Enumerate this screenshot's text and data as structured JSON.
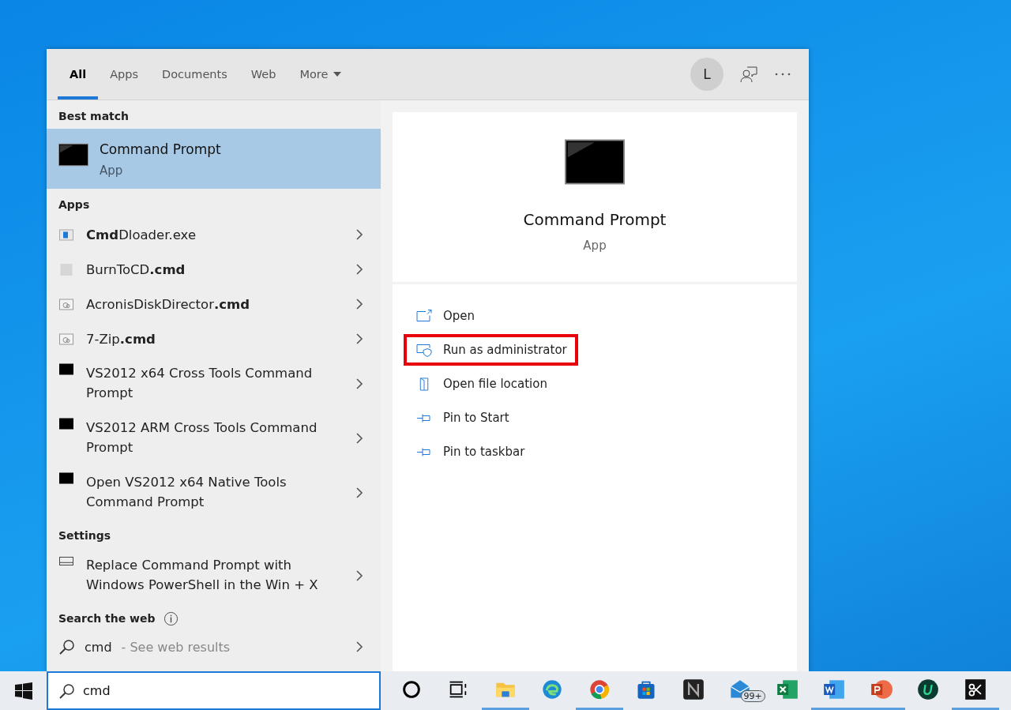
{
  "tabs": [
    {
      "label": "All",
      "selected": true
    },
    {
      "label": "Apps",
      "selected": false
    },
    {
      "label": "Documents",
      "selected": false
    },
    {
      "label": "Web",
      "selected": false
    },
    {
      "label": "More",
      "selected": false,
      "dropdown": true
    }
  ],
  "account": {
    "initial": "L"
  },
  "best_match": {
    "heading": "Best match",
    "item": {
      "title": "Command Prompt",
      "subtitle": "App",
      "selected": true
    }
  },
  "apps": {
    "heading": "Apps",
    "items": [
      {
        "kind": "exe",
        "label": "**Cmd**Dloader.exe"
      },
      {
        "kind": "blank",
        "label": "BurnToCD**.cmd**"
      },
      {
        "kind": "script",
        "label": "AcronisDiskDirector**.cmd**"
      },
      {
        "kind": "script",
        "label": "7-Zip**.cmd**"
      },
      {
        "kind": "console",
        "label": "VS2012 x64 Cross Tools Command Prompt"
      },
      {
        "kind": "console",
        "label": "VS2012 ARM Cross Tools Command Prompt"
      },
      {
        "kind": "console",
        "label": "Open VS2012 x64 Native Tools Command Prompt"
      }
    ]
  },
  "settings": {
    "heading": "Settings",
    "items": [
      {
        "kind": "display",
        "label": "Replace Command Prompt with Windows PowerShell in the Win + X"
      }
    ]
  },
  "web": {
    "heading": "Search the web",
    "query": "cmd",
    "hint": "- See web results"
  },
  "preview": {
    "title": "Command Prompt",
    "subtitle": "App",
    "actions": [
      {
        "kind": "open",
        "label": "Open",
        "highlighted": false
      },
      {
        "kind": "admin",
        "label": "Run as administrator",
        "highlighted": true
      },
      {
        "kind": "folder",
        "label": "Open file location",
        "highlighted": false
      },
      {
        "kind": "pin",
        "label": "Pin to Start",
        "highlighted": false
      },
      {
        "kind": "pin",
        "label": "Pin to taskbar",
        "highlighted": false
      }
    ]
  },
  "taskbar": {
    "search_value": "cmd",
    "apps": [
      {
        "kind": "cortana",
        "running": false
      },
      {
        "kind": "taskview",
        "running": false
      },
      {
        "kind": "explorer",
        "running": true
      },
      {
        "kind": "edge",
        "running": false
      },
      {
        "kind": "chrome",
        "running": true
      },
      {
        "kind": "store",
        "running": false
      },
      {
        "kind": "n-app",
        "running": false
      },
      {
        "kind": "mail",
        "running": false,
        "badge": "99+"
      },
      {
        "kind": "excel",
        "running": false
      },
      {
        "kind": "word",
        "running": true
      },
      {
        "kind": "powerpoint",
        "running": true
      },
      {
        "kind": "u-app",
        "running": false
      },
      {
        "kind": "snip",
        "running": true
      }
    ]
  }
}
